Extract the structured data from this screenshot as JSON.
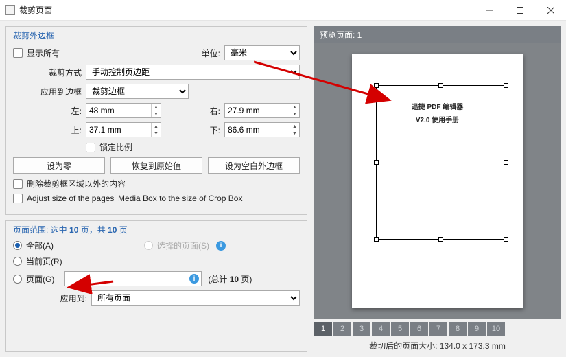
{
  "title": "裁剪页面",
  "group1": {
    "title": "裁剪外边框",
    "show_all_label": "显示所有",
    "unit_label": "单位:",
    "unit_value": "毫米",
    "crop_method_label": "裁剪方式",
    "crop_method_value": "手动控制页边距",
    "apply_to_box_label": "应用到边框",
    "apply_to_box_value": "裁剪边框",
    "left_label": "左:",
    "left_value": "48 mm",
    "right_label": "右:",
    "right_value": "27.9 mm",
    "top_label": "上:",
    "top_value": "37.1 mm",
    "bottom_label": "下:",
    "bottom_value": "86.6 mm",
    "lock_ratio_label": "锁定比例",
    "btn_zero": "设为零",
    "btn_restore": "恢复到原始值",
    "btn_blank": "设为空白外边框",
    "delete_outside_label": "删除裁剪框区域以外的内容",
    "adjust_media_label": "Adjust size of the pages' Media Box to the size of Crop Box"
  },
  "group2": {
    "title_prefix": "页面范围: 选中 ",
    "title_mid": "10",
    "title_mid2": " 页，共 ",
    "title_end": "10",
    "title_suffix": " 页",
    "all_label": "全部(A)",
    "selected_label": "选择的页面(S)",
    "current_label": "当前页(R)",
    "pages_label": "页面(G)",
    "total_label_prefix": "(总计 ",
    "total_count": "10",
    "total_label_suffix": " 页)",
    "apply_to_label": "应用到:",
    "apply_to_value": "所有页面"
  },
  "preview": {
    "header_prefix": "预览页面: ",
    "header_num": "1",
    "doc_line1": "迅捷 PDF 编辑器",
    "doc_line2": "V2.0 使用手册",
    "pages": [
      "1",
      "2",
      "3",
      "4",
      "5",
      "6",
      "7",
      "8",
      "9",
      "10"
    ],
    "size_text": "裁切后的页面大小:  134.0 x 173.3  mm"
  }
}
